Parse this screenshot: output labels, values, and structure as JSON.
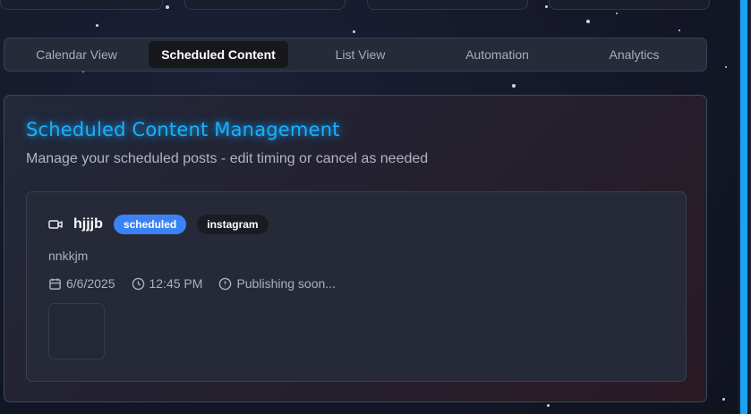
{
  "tabs": [
    {
      "label": "Calendar View",
      "active": false
    },
    {
      "label": "Scheduled Content",
      "active": true
    },
    {
      "label": "List View",
      "active": false
    },
    {
      "label": "Automation",
      "active": false
    },
    {
      "label": "Analytics",
      "active": false
    }
  ],
  "panel": {
    "title": "Scheduled Content Management",
    "subtitle": "Manage your scheduled posts - edit timing or cancel as needed"
  },
  "post": {
    "icon": "video-icon",
    "title": "hjjjb",
    "status_badge": "scheduled",
    "platform_badge": "instagram",
    "description": "nnkkjm",
    "date": "6/6/2025",
    "time": "12:45 PM",
    "status_text": "Publishing soon..."
  },
  "colors": {
    "accent": "#1ab0ff",
    "badge_scheduled": "#3b82f6",
    "edge_bar": "#19a3f0"
  }
}
